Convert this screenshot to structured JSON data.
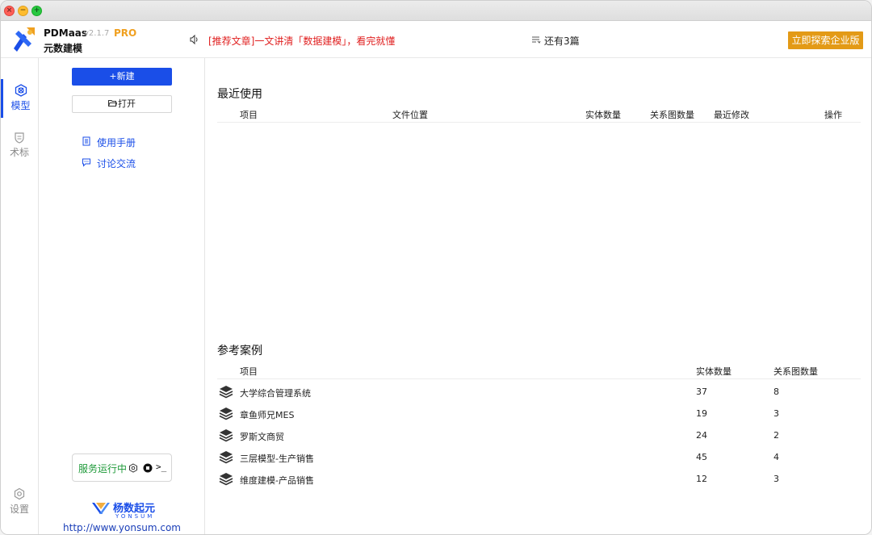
{
  "window": {
    "title_buttons": [
      "close",
      "minimize",
      "zoom"
    ]
  },
  "header": {
    "app_name": "PDMaas",
    "version": "v2.1.7",
    "edition": "PRO",
    "subtitle": "元数建模",
    "news_text": "[推荐文章]一文讲清「数据建模」，看完就懂",
    "more_text": "还有3篇",
    "enterprise_button": "立即探索企业版",
    "colors": {
      "accent": "#1a4ee8",
      "orange": "#e39a16",
      "news_red": "#e02020"
    }
  },
  "leftnav": {
    "items": [
      {
        "label": "模型",
        "icon": "model-icon",
        "active": true
      },
      {
        "label": "术标",
        "icon": "term-icon",
        "active": false
      },
      {
        "label": "设置",
        "icon": "settings-gear-icon",
        "active": false
      }
    ]
  },
  "sidepanel": {
    "new_button": "+新建",
    "open_button": "打开",
    "links": [
      {
        "label": "使用手册",
        "icon": "manual-icon"
      },
      {
        "label": "讨论交流",
        "icon": "chat-icon"
      }
    ],
    "service_status": "服务运行中",
    "terminal_glyph": ">_",
    "brand_name": "杨数起元",
    "brand_sub": "YONSUM",
    "brand_url": "http://www.yonsum.com"
  },
  "recent": {
    "title": "最近使用",
    "columns": [
      "项目",
      "文件位置",
      "实体数量",
      "关系图数量",
      "最近修改",
      "操作"
    ],
    "rows": []
  },
  "reference": {
    "title": "参考案例",
    "columns": [
      "项目",
      "实体数量",
      "关系图数量"
    ],
    "rows": [
      {
        "name": "大学综合管理系统",
        "entities": "37",
        "diagrams": "8"
      },
      {
        "name": "章鱼师兄MES",
        "entities": "19",
        "diagrams": "3"
      },
      {
        "name": "罗斯文商贸",
        "entities": "24",
        "diagrams": "2"
      },
      {
        "name": "三层模型-生产销售",
        "entities": "45",
        "diagrams": "4"
      },
      {
        "name": "维度建模-产品销售",
        "entities": "12",
        "diagrams": "3"
      }
    ]
  }
}
